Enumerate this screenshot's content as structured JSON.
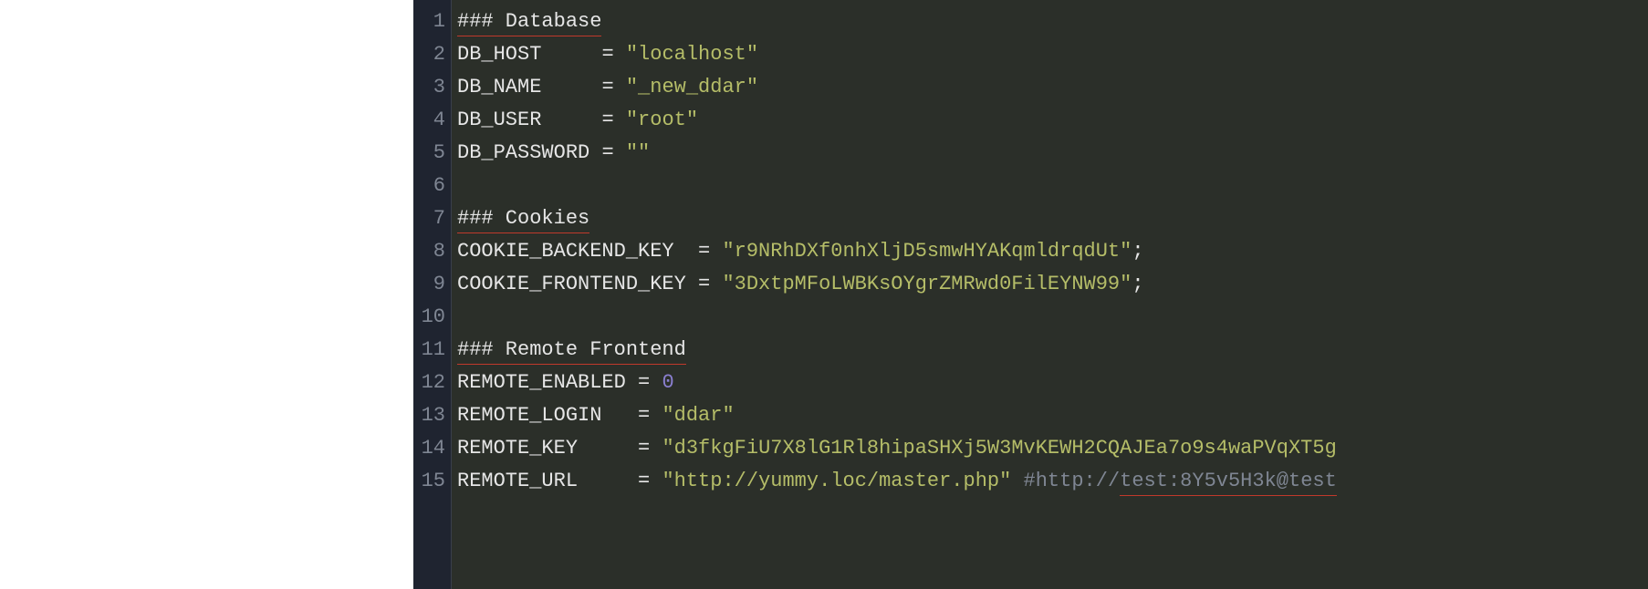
{
  "gutter": {
    "start": 1,
    "end": 15
  },
  "code": {
    "lines": [
      {
        "type": "heading",
        "text": "### Database"
      },
      {
        "type": "assign",
        "var": "DB_HOST",
        "pad": "    ",
        "value": "\"localhost\"",
        "valClass": "str"
      },
      {
        "type": "assign",
        "var": "DB_NAME",
        "pad": "    ",
        "value": "\"_new_ddar\"",
        "valClass": "str"
      },
      {
        "type": "assign",
        "var": "DB_USER",
        "pad": "    ",
        "value": "\"root\"",
        "valClass": "str"
      },
      {
        "type": "assign",
        "var": "DB_PASSWORD",
        "pad": "",
        "value": "\"\"",
        "valClass": "str"
      },
      {
        "type": "blank"
      },
      {
        "type": "heading",
        "text": "### Cookies"
      },
      {
        "type": "assign-semi",
        "var": "COOKIE_BACKEND_KEY",
        "pad": " ",
        "value": "\"r9NRhDXf0nhXljD5smwHYAKqmldrqdUt\"",
        "valClass": "str"
      },
      {
        "type": "assign-semi",
        "var": "COOKIE_FRONTEND_KEY",
        "pad": "",
        "value": "\"3DxtpMFoLWBKsOYgrZMRwd0FilEYNW99\"",
        "valClass": "str"
      },
      {
        "type": "blank"
      },
      {
        "type": "heading",
        "text": "### Remote Frontend"
      },
      {
        "type": "assign",
        "var": "REMOTE_ENABLED",
        "pad": "",
        "value": "0",
        "valClass": "num"
      },
      {
        "type": "assign",
        "var": "REMOTE_LOGIN",
        "pad": "  ",
        "value": "\"ddar\"",
        "valClass": "str"
      },
      {
        "type": "assign",
        "var": "REMOTE_KEY",
        "pad": "    ",
        "value": "\"d3fkgFiU7X8lG1Rl8hipaSHXj5W3MvKEWH2CQAJEa7o9s4waPVqXT5g",
        "valClass": "str"
      },
      {
        "type": "assign-comment",
        "var": "REMOTE_URL",
        "pad": "    ",
        "value": "\"http://yummy.loc/master.php\"",
        "valClass": "str",
        "commentPart": "#http://",
        "commentErr": "test:8Y5v5H3k@test"
      }
    ]
  }
}
